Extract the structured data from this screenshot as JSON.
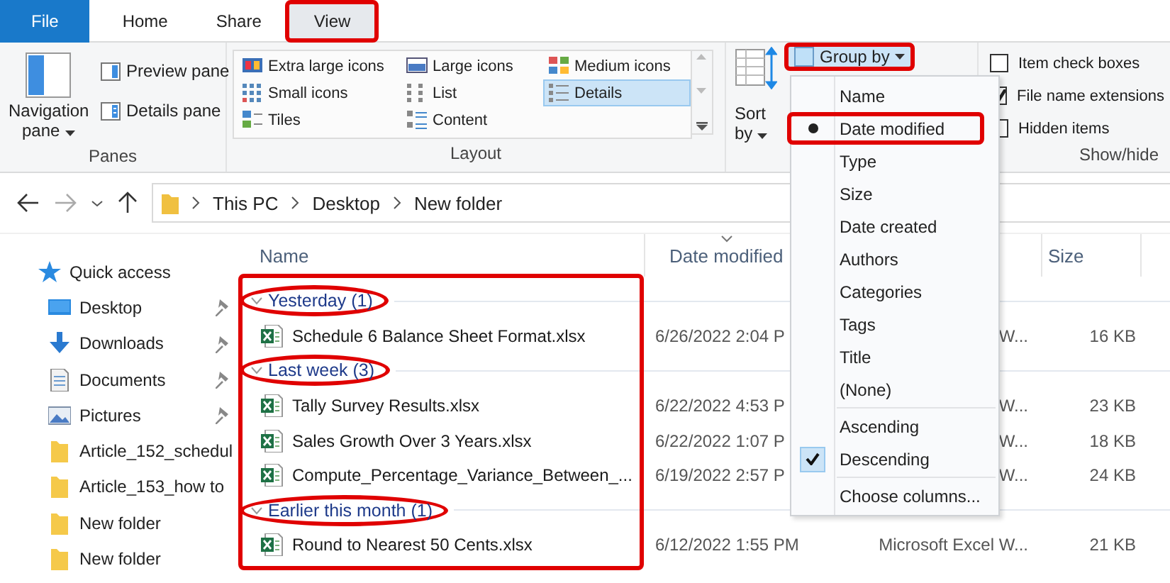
{
  "tabs": [
    {
      "label": "File",
      "kind": "file",
      "selected": false,
      "highlighted": false
    },
    {
      "label": "Home",
      "kind": "tab",
      "selected": false,
      "highlighted": false
    },
    {
      "label": "Share",
      "kind": "tab",
      "selected": false,
      "highlighted": false
    },
    {
      "label": "View",
      "kind": "tab",
      "selected": true,
      "highlighted": true
    }
  ],
  "ribbon": {
    "panes": {
      "title": "Panes",
      "navigation_pane": "Navigation pane",
      "preview_pane": "Preview pane",
      "details_pane": "Details pane"
    },
    "layout": {
      "title": "Layout",
      "options": [
        {
          "label": "Extra large icons",
          "kind": "xl",
          "selected": false
        },
        {
          "label": "Large icons",
          "kind": "large",
          "selected": false
        },
        {
          "label": "Medium icons",
          "kind": "medium",
          "selected": false
        },
        {
          "label": "Small icons",
          "kind": "small",
          "selected": false
        },
        {
          "label": "List",
          "kind": "list",
          "selected": false
        },
        {
          "label": "Details",
          "kind": "details",
          "selected": true
        },
        {
          "label": "Tiles",
          "kind": "tiles",
          "selected": false
        },
        {
          "label": "Content",
          "kind": "content",
          "selected": false
        }
      ]
    },
    "current_view": {
      "sort_by": "Sort by",
      "group_by": {
        "label": "Group by",
        "highlighted": true
      }
    },
    "show_hide": {
      "title": "Show/hide",
      "options": [
        {
          "label": "Item check boxes",
          "checked": false
        },
        {
          "label": "File name extensions",
          "checked": true
        },
        {
          "label": "Hidden items",
          "checked": false
        }
      ]
    }
  },
  "address_bar": {
    "path": [
      "This PC",
      "Desktop",
      "New folder"
    ]
  },
  "navigation": {
    "items": [
      {
        "label": "Quick access",
        "kind": "star",
        "pinned": false
      },
      {
        "label": "Desktop",
        "kind": "desktop",
        "pinned": true
      },
      {
        "label": "Downloads",
        "kind": "downloads",
        "pinned": true
      },
      {
        "label": "Documents",
        "kind": "documents",
        "pinned": true
      },
      {
        "label": "Pictures",
        "kind": "pictures",
        "pinned": true
      },
      {
        "label": "Article_152_schedul",
        "kind": "folder",
        "pinned": false
      },
      {
        "label": "Article_153_how to",
        "kind": "folder",
        "pinned": false
      },
      {
        "label": "New folder",
        "kind": "folder",
        "pinned": false
      },
      {
        "label": "New folder",
        "kind": "folder",
        "pinned": false
      }
    ]
  },
  "file_list": {
    "highlighted": true,
    "columns": [
      {
        "label": "Name",
        "sorted": false
      },
      {
        "label": "Date modified",
        "sorted": true
      },
      {
        "label": "Size",
        "sorted": false
      }
    ],
    "groups": [
      {
        "label": "Yesterday (1)",
        "expanded": true,
        "highlighted": true,
        "files": [
          {
            "name": "Schedule 6 Balance Sheet Format.xlsx",
            "date_modified": "6/26/2022 2:04 P",
            "type": "W...",
            "size": "16 KB"
          }
        ]
      },
      {
        "label": "Last week (3)",
        "expanded": true,
        "highlighted": true,
        "files": [
          {
            "name": "Tally Survey Results.xlsx",
            "date_modified": "6/22/2022 4:53 P",
            "type": "W...",
            "size": "23 KB"
          },
          {
            "name": "Sales Growth Over 3 Years.xlsx",
            "date_modified": "6/22/2022 1:07 P",
            "type": "W...",
            "size": "18 KB"
          },
          {
            "name": "Compute_Percentage_Variance_Between_...",
            "date_modified": "6/19/2022 2:57 P",
            "type": "W...",
            "size": "24 KB"
          }
        ]
      },
      {
        "label": "Earlier this month (1)",
        "expanded": true,
        "highlighted": true,
        "files": [
          {
            "name": "Round to Nearest 50 Cents.xlsx",
            "date_modified": "6/12/2022 1:55 PM",
            "type": "Microsoft Excel W...",
            "size": "21 KB"
          }
        ]
      }
    ]
  },
  "group_menu": {
    "items": [
      {
        "label": "Name",
        "selected": false,
        "highlighted": false
      },
      {
        "label": "Date modified",
        "selected": true,
        "highlighted": true
      },
      {
        "label": "Type",
        "selected": false,
        "highlighted": false
      },
      {
        "label": "Size",
        "selected": false,
        "highlighted": false
      },
      {
        "label": "Date created",
        "selected": false,
        "highlighted": false
      },
      {
        "label": "Authors",
        "selected": false,
        "highlighted": false
      },
      {
        "label": "Categories",
        "selected": false,
        "highlighted": false
      },
      {
        "label": "Tags",
        "selected": false,
        "highlighted": false
      },
      {
        "label": "Title",
        "selected": false,
        "highlighted": false
      },
      {
        "label": "(None)",
        "selected": false,
        "highlighted": false
      }
    ],
    "order": [
      {
        "label": "Ascending",
        "selected": false
      },
      {
        "label": "Descending",
        "selected": true
      }
    ],
    "choose_columns": "Choose columns..."
  }
}
